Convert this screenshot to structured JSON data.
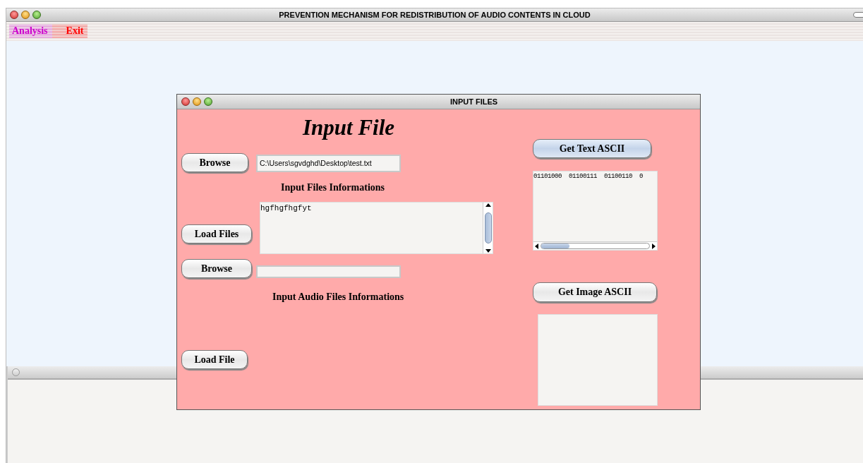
{
  "window": {
    "title": "PREVENTION MECHANISM FOR REDISTRIBUTION OF AUDIO CONTENTS IN CLOUD"
  },
  "menu": [
    {
      "label": "Analysis",
      "color": "#cc00cc"
    },
    {
      "label": "Exit",
      "color": "#ff0000"
    }
  ],
  "dialog": {
    "title": "INPUT FILES",
    "heading": "Input File",
    "left_buttons": [
      {
        "label": "Browse",
        "focused": false
      },
      {
        "label": "Load Files",
        "focused": false
      },
      {
        "label": "Browse",
        "focused": false
      },
      {
        "label": "Load File",
        "focused": false
      }
    ],
    "file_field": {
      "value": "C:\\Users\\sgvdghd\\Desktop\\test.txt"
    },
    "files_info_label": "Input Files Informations",
    "files_info": {
      "value": "hgfhgfhgfyt"
    },
    "audio_info_label": "Input Audio Files Informations",
    "text_ascii_button": {
      "label": "Get Text ASCII",
      "focused": true
    },
    "text_ascii": {
      "value": "01101000  01100111  01100110  0"
    },
    "image_ascii_button": {
      "label": "Get Image ASCII",
      "focused": false
    }
  }
}
